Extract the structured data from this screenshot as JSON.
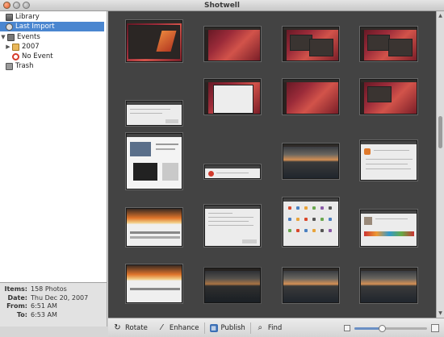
{
  "window": {
    "title": "Shotwell"
  },
  "sidebar": {
    "library": "Library",
    "last_import": "Last Import",
    "events": "Events",
    "year": "2007",
    "no_event": "No Event",
    "trash": "Trash"
  },
  "info": {
    "items_label": "Items:",
    "items_value": "158 Photos",
    "date_label": "Date:",
    "date_value": "Thu Dec 20, 2007",
    "from_label": "From:",
    "from_value": "6:51 AM",
    "to_label": "To:",
    "to_value": "6:53 AM"
  },
  "toolbar": {
    "rotate": "Rotate",
    "enhance": "Enhance",
    "publish": "Publish",
    "find": "Find"
  },
  "zoom": {
    "level": 0.38
  },
  "thumbnails": [
    "desktop-welcome",
    "desktop-red",
    "desktop-windows",
    "desktop-windows",
    "dialog-window",
    "desktop-document",
    "desktop-red",
    "desktop-windows",
    "browser-page",
    "dialog-small",
    "lake-screens",
    "webpage-article",
    "fire-webpage",
    "dialog-list",
    "icon-grid",
    "webpage-profile",
    "fire-webpage",
    "lake-dark",
    "lake-sunset",
    "lake-sunset"
  ],
  "colors": {
    "selection": "#4a86d0",
    "viewer_bg": "#434343"
  }
}
